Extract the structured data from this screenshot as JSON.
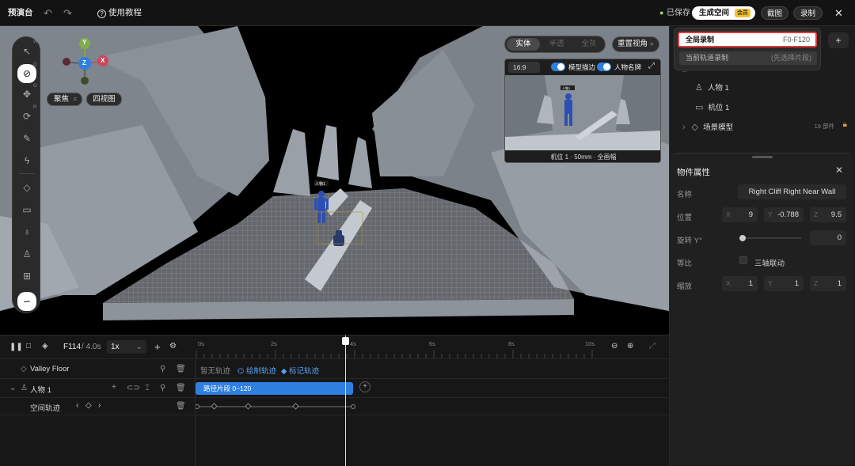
{
  "topbar": {
    "title": "预演台",
    "help": "使用教程",
    "saved": "已保存",
    "generate": "生成空间",
    "member": "会员",
    "screenshot": "截图",
    "record": "录制"
  },
  "record_menu": {
    "full_label": "全局录制",
    "full_range": "F0-F120",
    "current_label": "当前轨道录制",
    "current_hint": "(先选择片段)"
  },
  "viewport": {
    "focus": "聚焦",
    "focus_key": "F",
    "quad": "四视图",
    "gizmo": {
      "x": "X",
      "y": "Y",
      "z": "Z"
    },
    "modes": [
      "实体",
      "半透",
      "全灰"
    ],
    "reset": "重置视角",
    "person_tag": "人物1",
    "tool_keys": {
      "w": "W",
      "q": "Q",
      "e": "E",
      "g": "G",
      "r": "R"
    }
  },
  "preview": {
    "ratio": "16:9",
    "outline": "模型描边",
    "nameplate": "人物名牌",
    "caption": "机位 1 · 50mm · 全画幅",
    "tag": "人物1"
  },
  "scene_tree": {
    "items": [
      {
        "label": "人物 1"
      },
      {
        "label": "机位 1"
      },
      {
        "label": "场景模型",
        "count": "19 部件"
      }
    ]
  },
  "props": {
    "title": "物件属性",
    "name_label": "名称",
    "name": "Right Cliff Right Near Wall",
    "pos_label": "位置",
    "pos": {
      "x": "9",
      "y": "-0.788",
      "z": "9.5"
    },
    "rot_label": "旋转 Y°",
    "rot": "0",
    "ratio_label": "等比",
    "link": "三轴联动",
    "scale_label": "缩放",
    "scale": {
      "x": "1",
      "y": "1",
      "z": "1"
    }
  },
  "timeline": {
    "frame": "F114",
    "time": "/ 4.0s",
    "speed": "1x",
    "ticks": [
      "0s",
      "2s",
      "4s",
      "6s",
      "8s",
      "10s"
    ],
    "tracks": {
      "floor": "Valley Floor",
      "no_track": "暂无轨迹",
      "draw": "绘制轨迹",
      "mark": "标记轨迹",
      "person": "人物 1",
      "segment": "路径片段 0~120",
      "spatial": "空间轨迹"
    }
  },
  "colors": {
    "accent": "#2f7fe0",
    "record_red": "#e03a3a",
    "member_gold": "#f2c230"
  }
}
